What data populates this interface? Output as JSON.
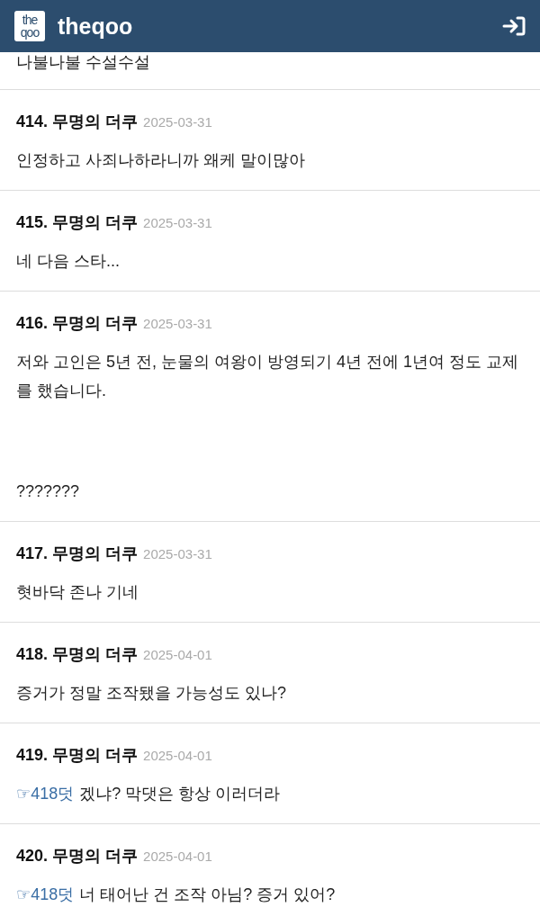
{
  "header": {
    "logo_top": "the",
    "logo_bottom": "qoo",
    "title": "theqoo"
  },
  "lead_text": "나불나불 수설수설",
  "comments": [
    {
      "number": "414.",
      "author": "무명의 더쿠",
      "date": "2025-03-31",
      "paragraphs": [
        "인정하고 사죄나하라니까 왜케 말이많아"
      ]
    },
    {
      "number": "415.",
      "author": "무명의 더쿠",
      "date": "2025-03-31",
      "paragraphs": [
        "네 다음 스타..."
      ]
    },
    {
      "number": "416.",
      "author": "무명의 더쿠",
      "date": "2025-03-31",
      "paragraphs": [
        "저와 고인은 5년 전, 눈물의 여왕이 방영되기 4년 전에 1년여 정도 교제를 했습니다.",
        "???????"
      ]
    },
    {
      "number": "417.",
      "author": "무명의 더쿠",
      "date": "2025-03-31",
      "paragraphs": [
        "혓바닥 존나 기네"
      ]
    },
    {
      "number": "418.",
      "author": "무명의 더쿠",
      "date": "2025-04-01",
      "paragraphs": [
        "증거가 정말 조작됐을 가능성도 있나?"
      ]
    },
    {
      "number": "419.",
      "author": "무명의 더쿠",
      "date": "2025-04-01",
      "reply_to": "☞418덧",
      "paragraphs": [
        "겠냐? 막댓은 항상 이러더라"
      ]
    },
    {
      "number": "420.",
      "author": "무명의 더쿠",
      "date": "2025-04-01",
      "reply_to": "☞418덧",
      "paragraphs": [
        "너 태어난 건 조작 아님? 증거 있어?"
      ]
    }
  ]
}
